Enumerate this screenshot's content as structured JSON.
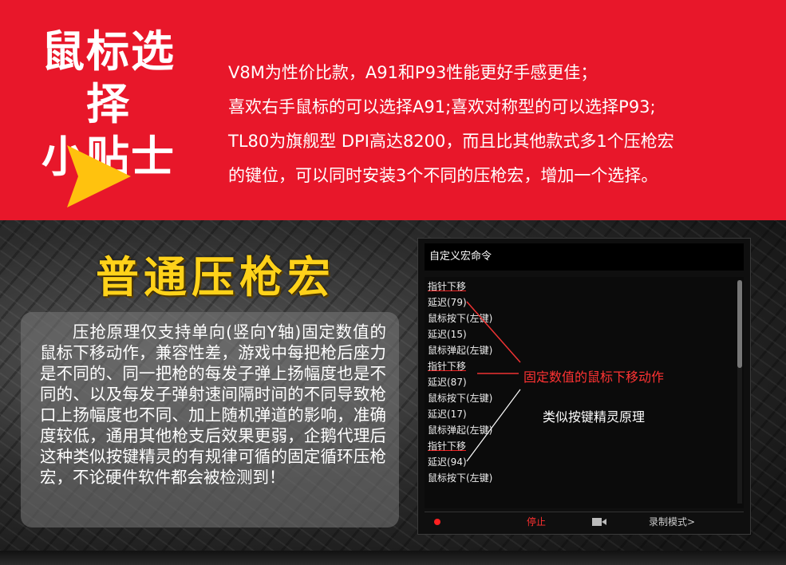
{
  "banner": {
    "title_line1": "鼠标选择",
    "title_line2": "小贴士",
    "tips": [
      "V8M为性价比款，A91和P93性能更好手感更佳；",
      "喜欢右手鼠标的可以选择A91;喜欢对称型的可以选择P93;",
      "TL80为旗舰型 DPI高达8200，而且比其他款式多1个压枪宏",
      "的键位，可以同时安装3个不同的压枪宏，增加一个选择。"
    ],
    "arrow_icon": "right-triangle-arrow-icon",
    "colors": {
      "background": "#e8172a",
      "arrow": "#ffc20e",
      "highlight_text": "#ffee55"
    }
  },
  "section": {
    "title": "普通压枪宏",
    "description": "压抢原理仅支持单向(竖向Y轴)固定数值的鼠标下移动作，兼容性差，游戏中每把枪后座力是不同的、同一把枪的每发子弹上扬幅度也是不同的、以及每发子弹射速间隔时间的不同导致枪口上扬幅度也不同、加上随机弹道的影响，准确度较低，通用其他枪支后效果更弱，企鹅代理后这种类似按键精灵的有规律可循的固定循环压枪宏，不论硬件软件都会被检测到！"
  },
  "macro": {
    "header": "自定义宏命令",
    "items": [
      "指针下移",
      "延迟(79)",
      "鼠标按下(左键)",
      "延迟(15)",
      "鼠标弹起(左键)",
      "指针下移",
      "延迟(87)",
      "鼠标按下(左键)",
      "延迟(17)",
      "鼠标弹起(左键)",
      "指针下移",
      "延迟(94)",
      "鼠标按下(左键)"
    ],
    "stop_label": "停止",
    "record_label": "录制模式>"
  },
  "callouts": {
    "red": "固定数值的鼠标下移动作",
    "white": "类似按键精灵原理"
  }
}
